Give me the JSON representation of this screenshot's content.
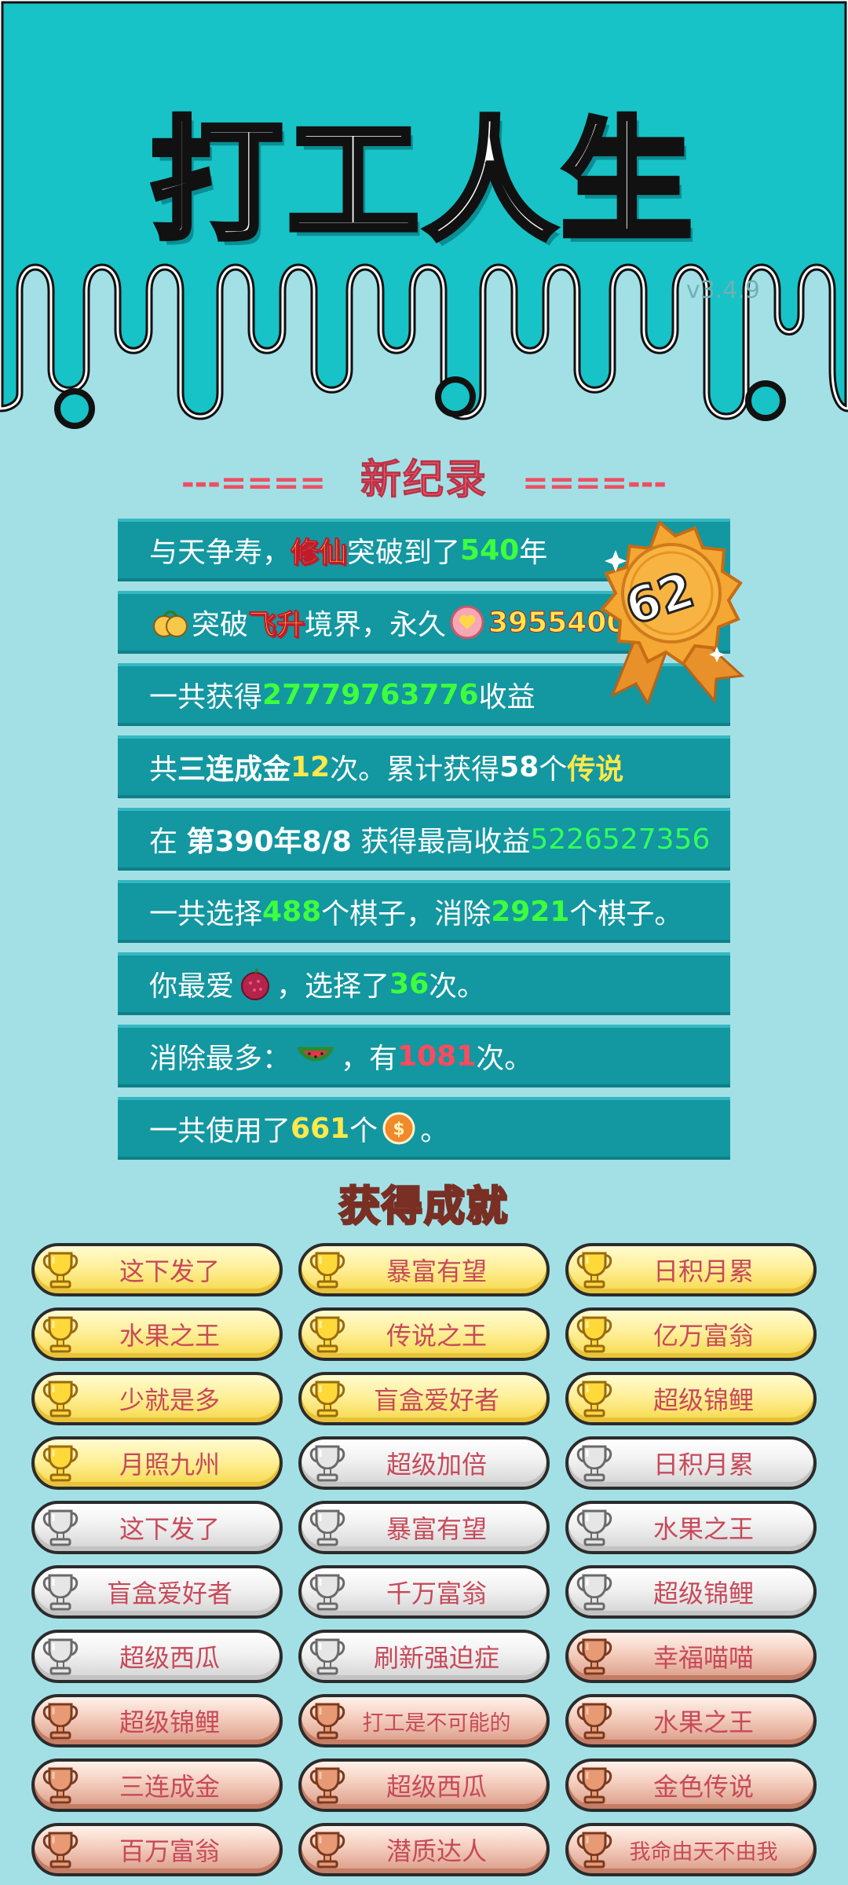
{
  "app": {
    "title": "打工人生",
    "version": "v3.4.9"
  },
  "colors": {
    "header_teal": "#17c3c6",
    "page_bg": "#a3e0e6",
    "record_row": "#1397a1",
    "highlight_yellow": "#ffe84a",
    "highlight_green": "#3dff3d",
    "highlight_red": "#ff4a5e",
    "heading_red": "#f3576a",
    "achievement_gold": "#f6d84a",
    "achievement_silver": "#d3d3d3",
    "achievement_bronze": "#d99a85"
  },
  "new_record": {
    "heading": "新纪录",
    "dashes_left": "---====",
    "dashes_right": "====---",
    "rank_badge": "62",
    "rows": [
      {
        "t1": "与天争寿，",
        "t2": "修仙",
        "t3": "突破到了",
        "t4": "540",
        "t5": "年"
      },
      {
        "icon": "golden-fruit-icon",
        "t1": "突破",
        "t2": "飞升",
        "t3": "境界，永久",
        "icon2": "heart-coin-icon",
        "t4": "3955400"
      },
      {
        "t1": "一共获得",
        "t2": "27779763776",
        "t3": "收益"
      },
      {
        "t1": "共",
        "t2": "三连成金",
        "t3": "12",
        "t4": "次。累计获得",
        "t5": "58",
        "t6": "个",
        "t7": "传说"
      },
      {
        "t1": "在 ",
        "t2": "第390年8/8",
        "t3": " 获得最高收益",
        "t4": "5226527356"
      },
      {
        "t1": "一共选择",
        "t2": "488",
        "t3": "个棋子，消除",
        "t4": "2921",
        "t5": "个棋子。"
      },
      {
        "t1": "你最爱",
        "icon": "lychee-icon",
        "t2": "，选择了",
        "t3": "36",
        "t4": "次。"
      },
      {
        "t1": "消除最多：",
        "icon": "watermelon-icon",
        "t2": "，有",
        "t3": "1081",
        "t4": "次。"
      },
      {
        "t1": "一共使用了",
        "t2": "661",
        "t3": "个",
        "icon": "coin-icon",
        "t4": "。"
      }
    ]
  },
  "achievements": {
    "heading": "获得成就",
    "items": [
      {
        "label": "这下发了",
        "tier": "gold"
      },
      {
        "label": "暴富有望",
        "tier": "gold"
      },
      {
        "label": "日积月累",
        "tier": "gold"
      },
      {
        "label": "水果之王",
        "tier": "gold"
      },
      {
        "label": "传说之王",
        "tier": "gold"
      },
      {
        "label": "亿万富翁",
        "tier": "gold"
      },
      {
        "label": "少就是多",
        "tier": "gold"
      },
      {
        "label": "盲盒爱好者",
        "tier": "gold"
      },
      {
        "label": "超级锦鲤",
        "tier": "gold"
      },
      {
        "label": "月照九州",
        "tier": "gold"
      },
      {
        "label": "超级加倍",
        "tier": "silver"
      },
      {
        "label": "日积月累",
        "tier": "silver"
      },
      {
        "label": "这下发了",
        "tier": "silver"
      },
      {
        "label": "暴富有望",
        "tier": "silver"
      },
      {
        "label": "水果之王",
        "tier": "silver"
      },
      {
        "label": "盲盒爱好者",
        "tier": "silver"
      },
      {
        "label": "千万富翁",
        "tier": "silver"
      },
      {
        "label": "超级锦鲤",
        "tier": "silver"
      },
      {
        "label": "超级西瓜",
        "tier": "silver"
      },
      {
        "label": "刷新强迫症",
        "tier": "silver"
      },
      {
        "label": "幸福喵喵",
        "tier": "bronze"
      },
      {
        "label": "超级锦鲤",
        "tier": "bronze"
      },
      {
        "label": "打工是不可能的",
        "tier": "bronze"
      },
      {
        "label": "水果之王",
        "tier": "bronze"
      },
      {
        "label": "三连成金",
        "tier": "bronze"
      },
      {
        "label": "超级西瓜",
        "tier": "bronze"
      },
      {
        "label": "金色传说",
        "tier": "bronze"
      },
      {
        "label": "百万富翁",
        "tier": "bronze"
      },
      {
        "label": "潜质达人",
        "tier": "bronze"
      },
      {
        "label": "我命由天不由我",
        "tier": "bronze"
      }
    ]
  }
}
